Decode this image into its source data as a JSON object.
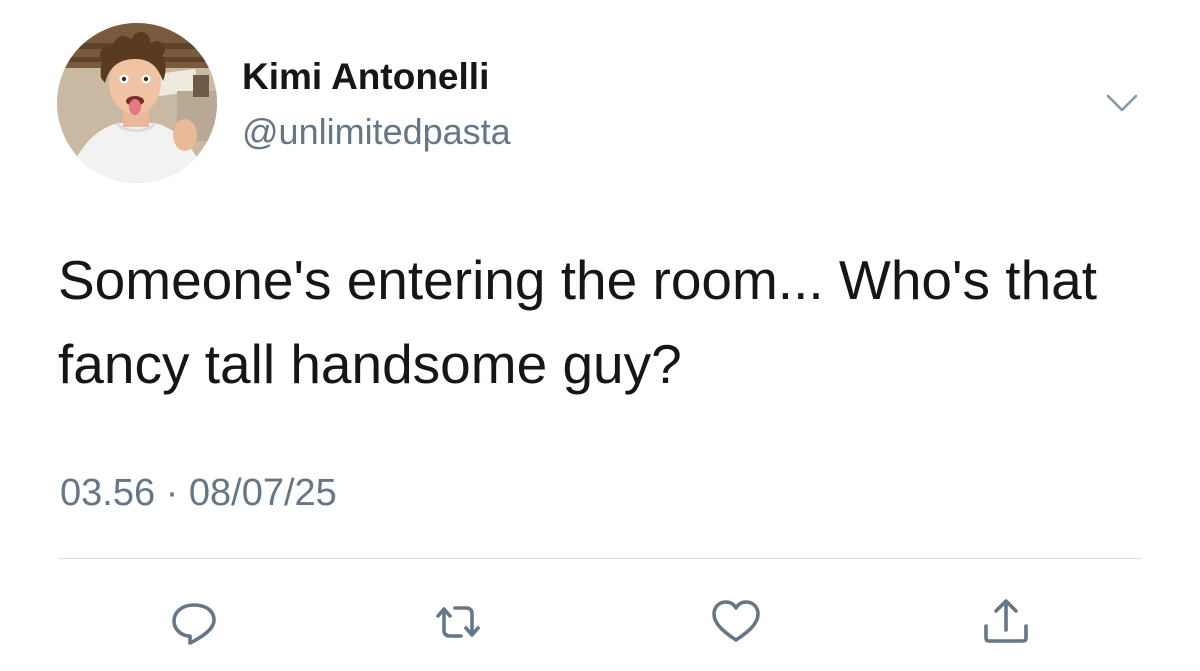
{
  "tweet": {
    "author": {
      "display_name": "Kimi Antonelli",
      "handle": "@unlimitedpasta"
    },
    "text": "Someone's entering the room... Who's that fancy tall handsome guy?",
    "timestamp": "03.56 · 08/07/25"
  },
  "actions": {
    "reply_icon": "reply-icon",
    "retweet_icon": "retweet-icon",
    "like_icon": "heart-icon",
    "share_icon": "share-icon",
    "icon_color": "#657786"
  },
  "colors": {
    "text_primary": "#14171a",
    "text_secondary": "#657786",
    "divider": "#d6dde3"
  }
}
